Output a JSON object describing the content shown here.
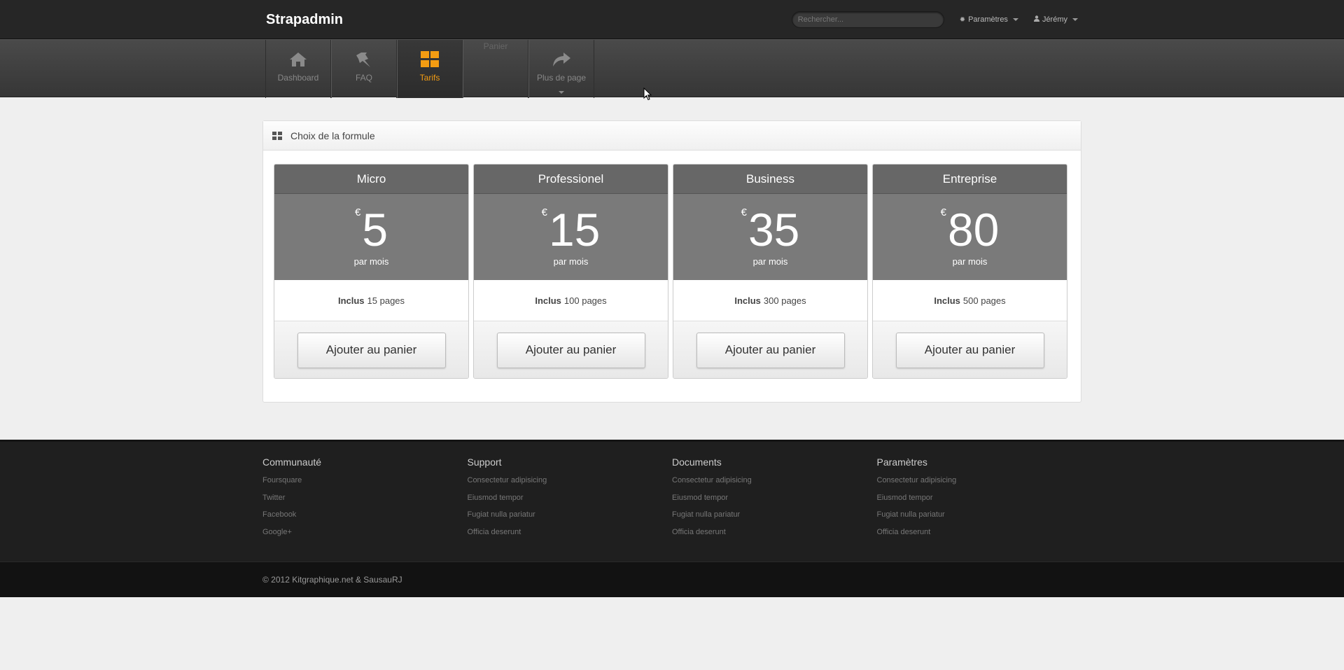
{
  "app": {
    "brand": "Strapadmin"
  },
  "topbar": {
    "search_placeholder": "Rechercher...",
    "settings_label": "Paramètres",
    "user_label": "Jérémy"
  },
  "nav": {
    "items": [
      {
        "label": "Dashboard",
        "icon": "home-icon"
      },
      {
        "label": "FAQ",
        "icon": "pin-icon"
      },
      {
        "label": "Tarifs",
        "icon": "grid-icon",
        "active": true
      },
      {
        "label": "Panier",
        "icon": "cart-icon"
      },
      {
        "label": "Plus de page",
        "icon": "share-icon"
      }
    ],
    "active_color": "#f39c12"
  },
  "panel": {
    "title": "Choix de la formule",
    "plans": [
      {
        "name": "Micro",
        "currency": "€",
        "amount": "5",
        "period": "par mois",
        "included_label": "Inclus",
        "included_value": "15 pages",
        "button": "Ajouter au panier"
      },
      {
        "name": "Professionel",
        "currency": "€",
        "amount": "15",
        "period": "par mois",
        "included_label": "Inclus",
        "included_value": "100 pages",
        "button": "Ajouter au panier"
      },
      {
        "name": "Business",
        "currency": "€",
        "amount": "35",
        "period": "par mois",
        "included_label": "Inclus",
        "included_value": "300 pages",
        "button": "Ajouter au panier"
      },
      {
        "name": "Entreprise",
        "currency": "€",
        "amount": "80",
        "period": "par mois",
        "included_label": "Inclus",
        "included_value": "500 pages",
        "button": "Ajouter au panier"
      }
    ]
  },
  "footer": {
    "columns": [
      {
        "title": "Communauté",
        "links": [
          "Foursquare",
          "Twitter",
          "Facebook",
          "Google+"
        ]
      },
      {
        "title": "Support",
        "links": [
          "Consectetur adipisicing",
          "Eiusmod tempor",
          "Fugiat nulla pariatur",
          "Officia deserunt"
        ]
      },
      {
        "title": "Documents",
        "links": [
          "Consectetur adipisicing",
          "Eiusmod tempor",
          "Fugiat nulla pariatur",
          "Officia deserunt"
        ]
      },
      {
        "title": "Paramètres",
        "links": [
          "Consectetur adipisicing",
          "Eiusmod tempor",
          "Fugiat nulla pariatur",
          "Officia deserunt"
        ]
      }
    ],
    "copyright": "© 2012 Kitgraphique.net & SausauRJ"
  }
}
